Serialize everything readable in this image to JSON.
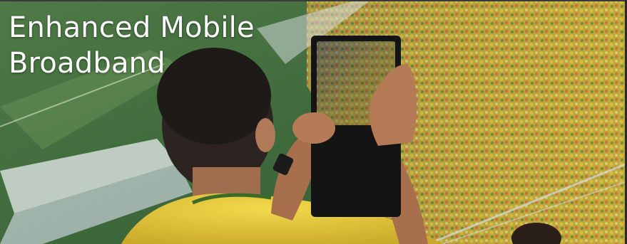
{
  "banner": {
    "headline": "Enhanced Mobile\nBroadband"
  }
}
